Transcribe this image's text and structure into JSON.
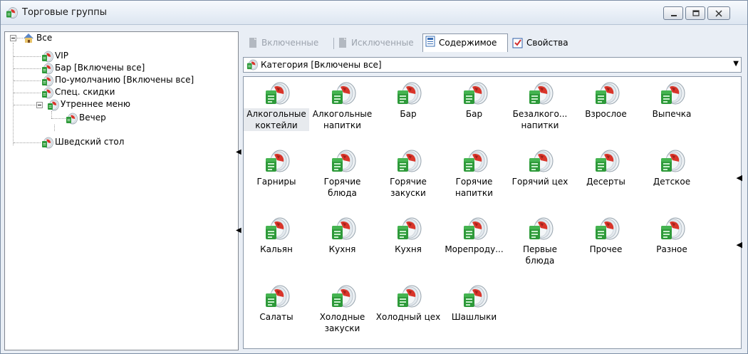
{
  "window": {
    "title": "Торговые группы",
    "icon": "trade-group-icon",
    "buttons": [
      "minimize-icon",
      "maximize-icon",
      "close-icon"
    ]
  },
  "tree": {
    "items": [
      {
        "label": "Все",
        "level": 0,
        "expanded": true,
        "icon": "home-icon"
      },
      {
        "label": "VIP",
        "level": 1,
        "icon": "trade-group-icon"
      },
      {
        "label": "Бар [Включены все]",
        "level": 1,
        "icon": "trade-group-icon"
      },
      {
        "label": "По-умолчанию [Включены все]",
        "level": 1,
        "icon": "trade-group-icon"
      },
      {
        "label": "Спец. скидки",
        "level": 1,
        "icon": "trade-group-icon"
      },
      {
        "label": "Утреннее меню",
        "level": 1,
        "expanded": true,
        "icon": "trade-group-icon"
      },
      {
        "label": "Вечер",
        "level": 2,
        "icon": "trade-group-icon"
      },
      {
        "label": "Шведский стол",
        "level": 1,
        "icon": "trade-group-icon"
      }
    ]
  },
  "tabs": [
    {
      "label": "Включенные",
      "active": false,
      "enabled": false,
      "icon": "document-icon"
    },
    {
      "label": "Исключенные",
      "active": false,
      "enabled": false,
      "icon": "document-icon"
    },
    {
      "label": "Содержимое",
      "active": true,
      "enabled": true,
      "icon": "content-icon"
    },
    {
      "label": "Свойства",
      "active": false,
      "enabled": true,
      "icon": "checkbox-properties-icon"
    }
  ],
  "category_select": {
    "value": "Категория [Включены все]",
    "icon": "trade-group-icon"
  },
  "categories": [
    {
      "label": "Алкогольные коктейли",
      "lines": [
        "Алкогольные",
        "коктейли"
      ],
      "selected": true,
      "icon": "category-folder-icon"
    },
    {
      "label": "Алкогольные напитки",
      "lines": [
        "Алкогольные",
        "напитки"
      ],
      "icon": "category-folder-icon"
    },
    {
      "label": "Бар",
      "lines": [
        "Бар"
      ],
      "icon": "category-folder-icon"
    },
    {
      "label": "Бар",
      "lines": [
        "Бар"
      ],
      "icon": "category-folder-icon"
    },
    {
      "label": "Безалкого... напитки",
      "lines": [
        "Безалкого...",
        "напитки"
      ],
      "icon": "category-folder-icon"
    },
    {
      "label": "Взрослое",
      "lines": [
        "Взрослое"
      ],
      "icon": "category-folder-icon"
    },
    {
      "label": "Выпечка",
      "lines": [
        "Выпечка"
      ],
      "icon": "category-folder-icon"
    },
    {
      "label": "Гарниры",
      "lines": [
        "Гарниры"
      ],
      "icon": "category-folder-icon"
    },
    {
      "label": "Горячие блюда",
      "lines": [
        "Горячие",
        "блюда"
      ],
      "icon": "category-folder-icon"
    },
    {
      "label": "Горячие закуски",
      "lines": [
        "Горячие",
        "закуски"
      ],
      "icon": "category-folder-icon"
    },
    {
      "label": "Горячие напитки",
      "lines": [
        "Горячие",
        "напитки"
      ],
      "icon": "category-folder-icon"
    },
    {
      "label": "Горячий цех",
      "lines": [
        "Горячий цех"
      ],
      "icon": "category-folder-icon"
    },
    {
      "label": "Десерты",
      "lines": [
        "Десерты"
      ],
      "icon": "category-folder-icon"
    },
    {
      "label": "Детское",
      "lines": [
        "Детское"
      ],
      "icon": "category-folder-icon"
    },
    {
      "label": "Кальян",
      "lines": [
        "Кальян"
      ],
      "icon": "category-folder-icon"
    },
    {
      "label": "Кухня",
      "lines": [
        "Кухня"
      ],
      "icon": "category-folder-icon"
    },
    {
      "label": "Кухня",
      "lines": [
        "Кухня"
      ],
      "icon": "category-folder-icon"
    },
    {
      "label": "Морепроду...",
      "lines": [
        "Морепроду..."
      ],
      "icon": "category-folder-icon"
    },
    {
      "label": "Первые блюда",
      "lines": [
        "Первые",
        "блюда"
      ],
      "icon": "category-folder-icon"
    },
    {
      "label": "Прочее",
      "lines": [
        "Прочее"
      ],
      "icon": "category-folder-icon"
    },
    {
      "label": "Разное",
      "lines": [
        "Разное"
      ],
      "icon": "category-folder-icon"
    },
    {
      "label": "Салаты",
      "lines": [
        "Салаты"
      ],
      "icon": "category-folder-icon"
    },
    {
      "label": "Холодные закуски",
      "lines": [
        "Холодные",
        "закуски"
      ],
      "icon": "category-folder-icon"
    },
    {
      "label": "Холодный цех",
      "lines": [
        "Холодный цех"
      ],
      "icon": "category-folder-icon"
    },
    {
      "label": "Шашлыки",
      "lines": [
        "Шашлыки"
      ],
      "icon": "category-folder-icon"
    }
  ],
  "colors": {
    "window_bg": "#e9eef5",
    "icon_green": "#2e9a3a",
    "icon_red": "#d9352a",
    "selection": "#e7eaee"
  }
}
